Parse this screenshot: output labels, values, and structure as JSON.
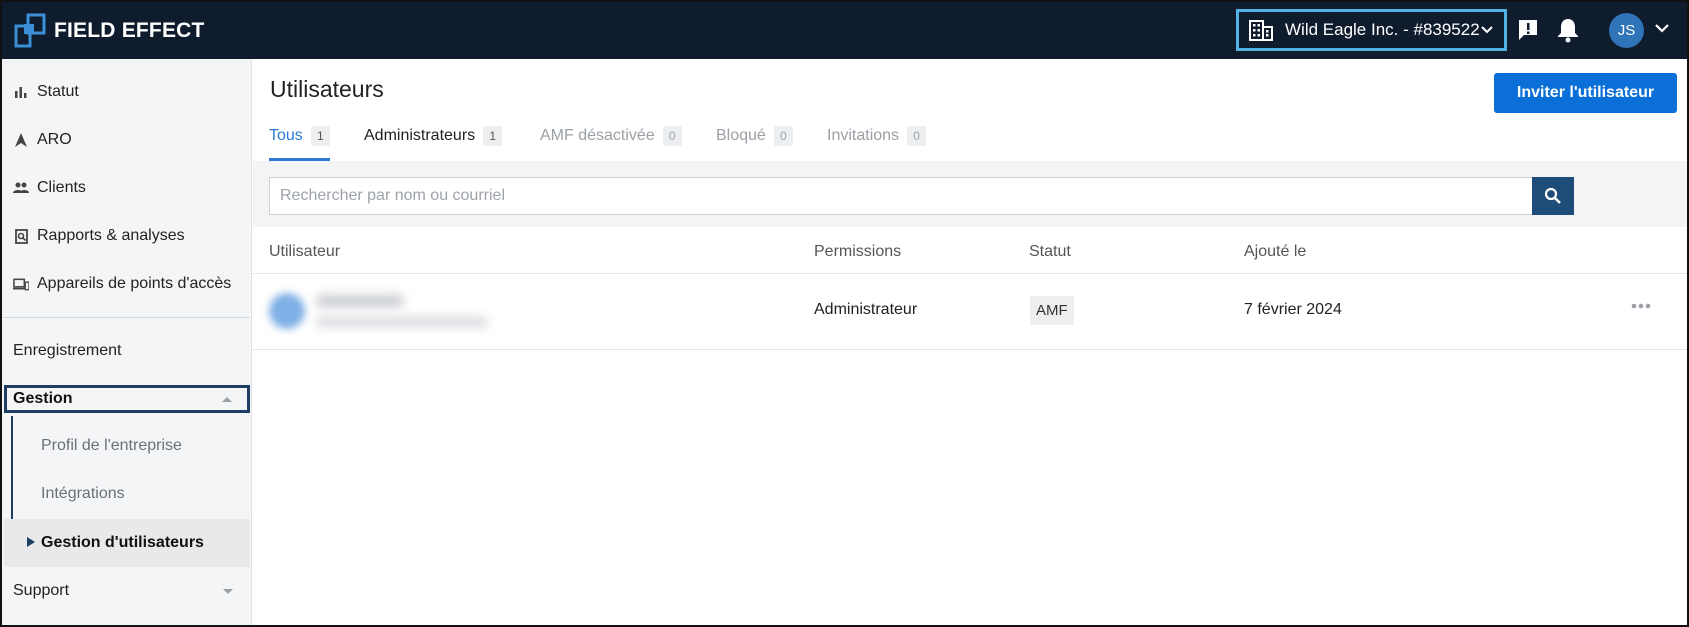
{
  "header": {
    "logo_text": "FIELD EFFECT",
    "org_selector": "Wild Eagle Inc. - #839522",
    "avatar_initials": "JS",
    "icons": [
      "building-icon",
      "chevron-down-icon",
      "feedback-icon",
      "bell-icon",
      "chevron-down-icon"
    ]
  },
  "sidebar": {
    "items": [
      {
        "label": "Statut",
        "icon": "bar-chart-icon"
      },
      {
        "label": "ARO",
        "icon": "navigation-arrow-icon"
      },
      {
        "label": "Clients",
        "icon": "people-icon"
      },
      {
        "label": "Rapports & analyses",
        "icon": "report-search-icon"
      },
      {
        "label": "Appareils de points d'accès",
        "icon": "devices-icon"
      }
    ],
    "enregistrement": "Enregistrement",
    "gestion": {
      "label": "Gestion",
      "children": [
        "Profil de l'entreprise",
        "Intégrations",
        "Gestion d'utilisateurs"
      ],
      "active": "Gestion d'utilisateurs"
    },
    "support": "Support"
  },
  "main": {
    "title": "Utilisateurs",
    "invite_button": "Inviter l'utilisateur",
    "tabs": [
      {
        "label": "Tous",
        "count": "1",
        "state": "active"
      },
      {
        "label": "Administrateurs",
        "count": "1",
        "state": "normal"
      },
      {
        "label": "AMF désactivée",
        "count": "0",
        "state": "muted"
      },
      {
        "label": "Bloqué",
        "count": "0",
        "state": "muted"
      },
      {
        "label": "Invitations",
        "count": "0",
        "state": "muted"
      }
    ],
    "search": {
      "placeholder": "Rechercher par nom ou courriel",
      "value": ""
    },
    "table": {
      "columns": [
        "Utilisateur",
        "Permissions",
        "Statut",
        "Ajouté le"
      ],
      "rows": [
        {
          "user": "",
          "permissions": "Administrateur",
          "status": "AMF",
          "added": "7 février 2024"
        }
      ]
    }
  },
  "colors": {
    "topbar": "#0f1c2e",
    "accent": "#0a6fd6",
    "tab_active": "#2a7bd4",
    "highlight_border": "#4fb3e6",
    "annotation": "#1e3f63"
  }
}
